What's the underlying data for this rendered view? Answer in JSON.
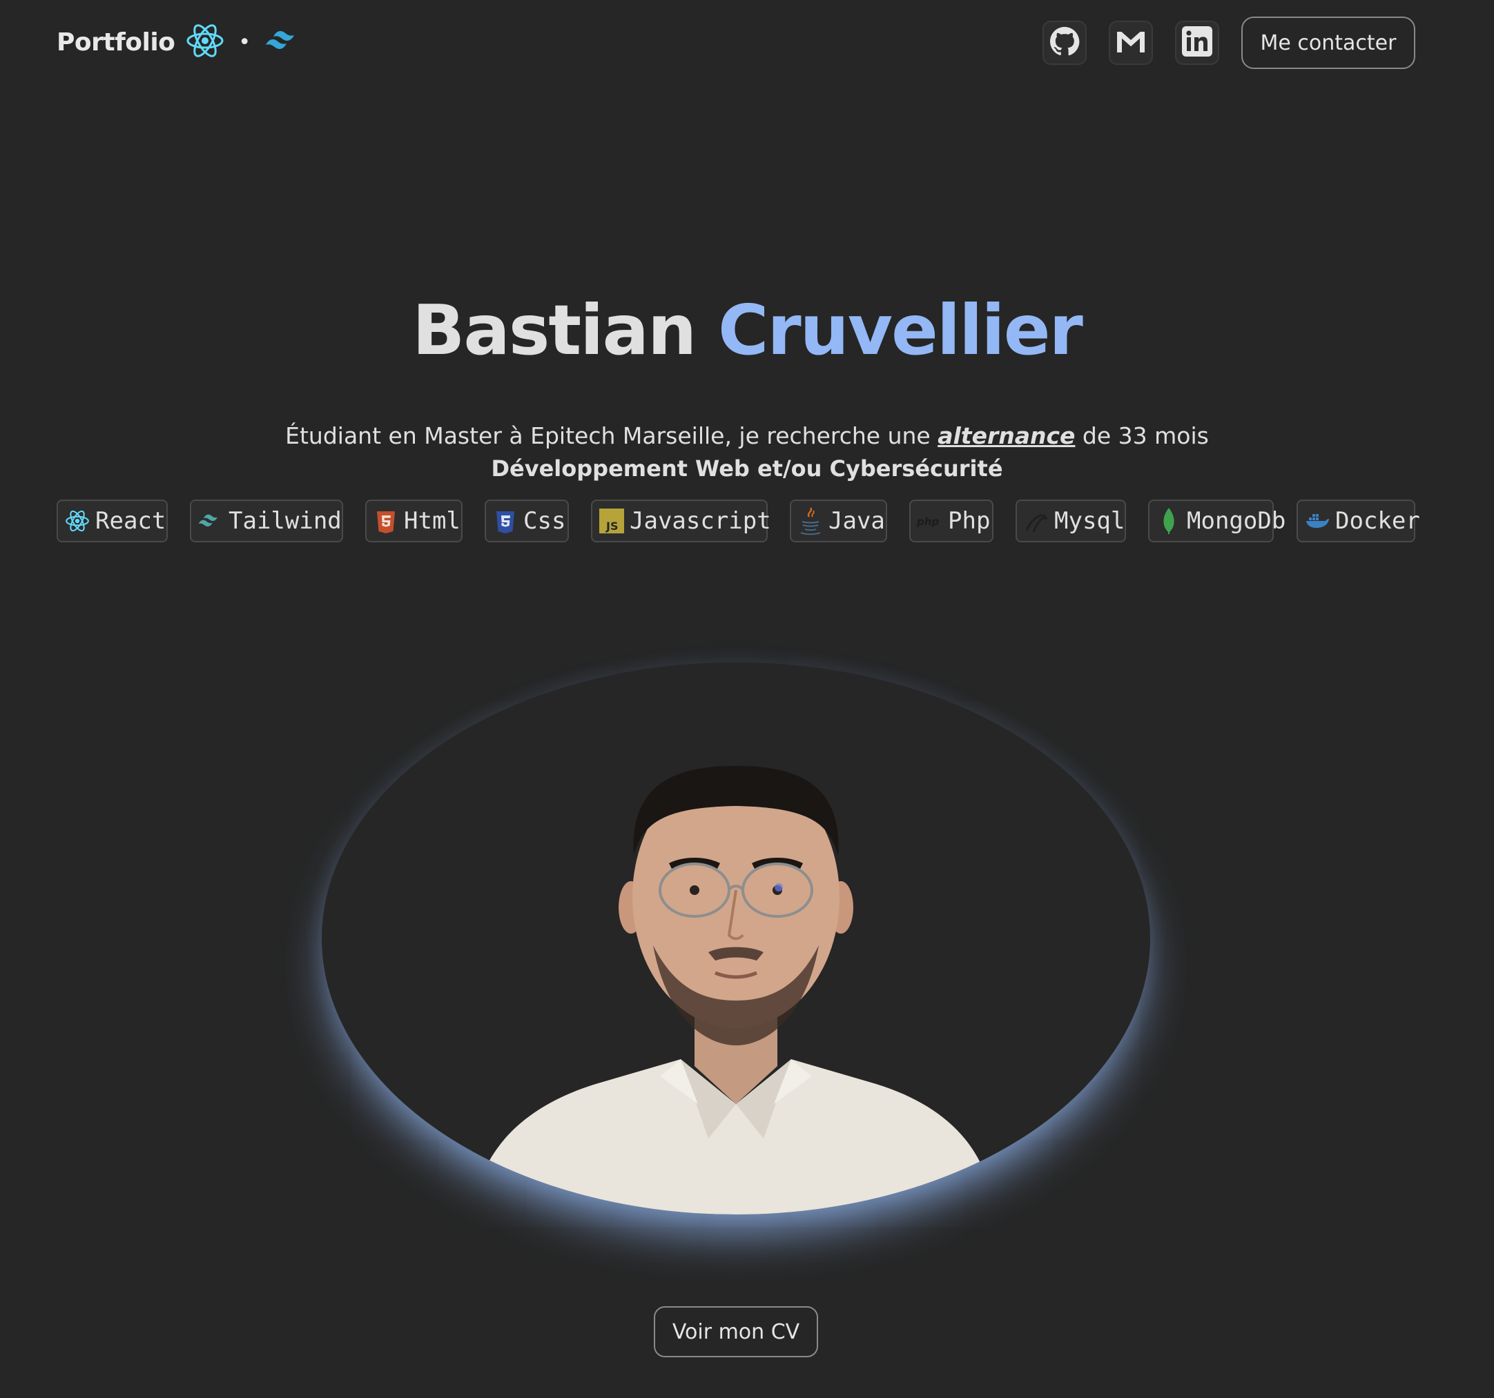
{
  "header": {
    "brand": "Portfolio",
    "separator": "•",
    "contact_label": "Me contacter",
    "social": [
      {
        "name": "github-icon"
      },
      {
        "name": "gmail-icon"
      },
      {
        "name": "linkedin-icon"
      }
    ]
  },
  "hero": {
    "first_name": "Bastian",
    "last_name": "Cruvellier",
    "tagline_before": "Étudiant en Master à Epitech Marseille, je recherche une ",
    "tagline_accent": "alternance",
    "tagline_after": " de 33 mois",
    "specialty": "Développement Web et/ou Cybersécurité"
  },
  "skills": [
    {
      "label": "React",
      "icon": "react-icon"
    },
    {
      "label": "Tailwind",
      "icon": "tailwind-icon"
    },
    {
      "label": "Html",
      "icon": "html5-icon"
    },
    {
      "label": "Css",
      "icon": "css3-icon"
    },
    {
      "label": "Javascript",
      "icon": "javascript-icon"
    },
    {
      "label": "Java",
      "icon": "java-icon"
    },
    {
      "label": "Php",
      "icon": "php-icon"
    },
    {
      "label": "Mysql",
      "icon": "mysql-icon"
    },
    {
      "label": "MongoDb",
      "icon": "mongodb-icon"
    },
    {
      "label": "Docker",
      "icon": "docker-icon"
    }
  ],
  "cv_label": "Voir mon CV",
  "colors": {
    "background": "#262626",
    "accent": "#93b8f5",
    "text": "#e0e0e0"
  }
}
